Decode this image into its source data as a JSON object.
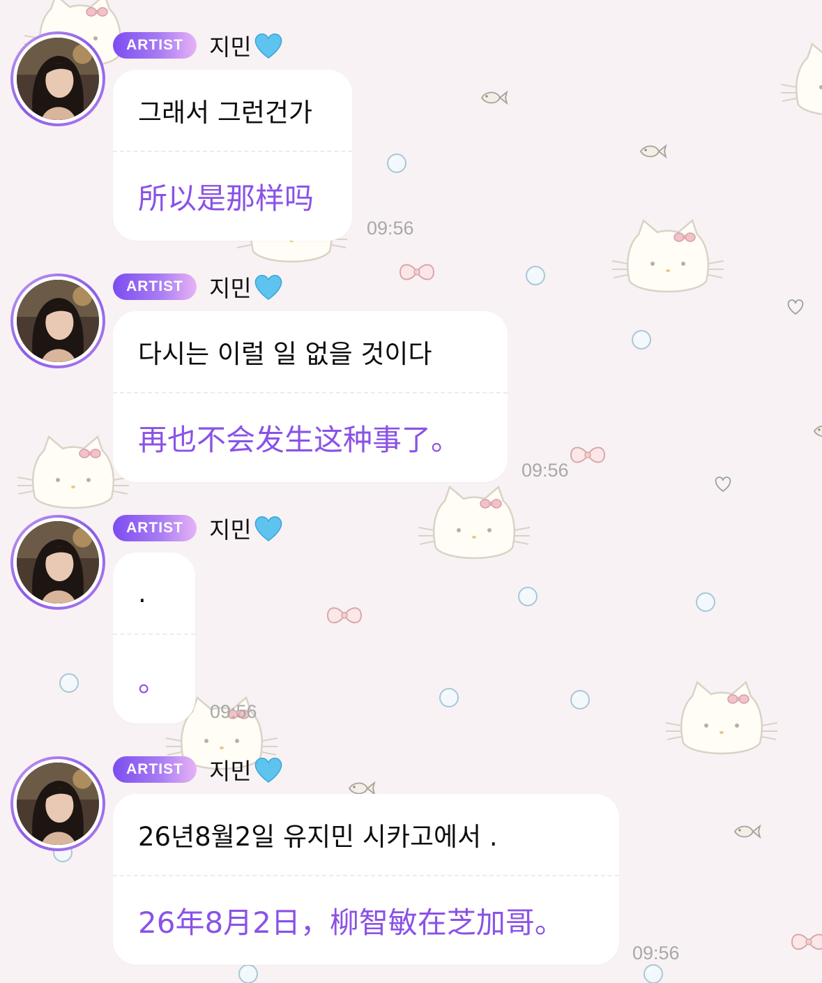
{
  "colors": {
    "background": "#f8f2f5",
    "badge_gradient_start": "#7c4df0",
    "badge_gradient_end": "#e6b3f5",
    "translation_text": "#8a52e6",
    "timestamp": "#a8a8a8",
    "heart": "#5fc3ef"
  },
  "background_icons": [
    "cat-face-icon",
    "bow-icon",
    "bubble-icon",
    "fish-icon",
    "heart-outline-icon"
  ],
  "messages": [
    {
      "badge": "ARTIST",
      "sender": "지민",
      "sender_icon": "blue-heart-icon",
      "original": "그래서 그런건가",
      "translation": "所以是那样吗",
      "time": "09:56"
    },
    {
      "badge": "ARTIST",
      "sender": "지민",
      "sender_icon": "blue-heart-icon",
      "original": "다시는 이럴 일 없을 것이다",
      "translation": "再也不会发生这种事了。",
      "time": "09:56"
    },
    {
      "badge": "ARTIST",
      "sender": "지민",
      "sender_icon": "blue-heart-icon",
      "original": ".",
      "translation": "。",
      "time": "09:56"
    },
    {
      "badge": "ARTIST",
      "sender": "지민",
      "sender_icon": "blue-heart-icon",
      "original": "26년8월2일 유지민 시카고에서 .",
      "translation": "26年8月2日，柳智敏在芝加哥。",
      "time": "09:56"
    }
  ]
}
